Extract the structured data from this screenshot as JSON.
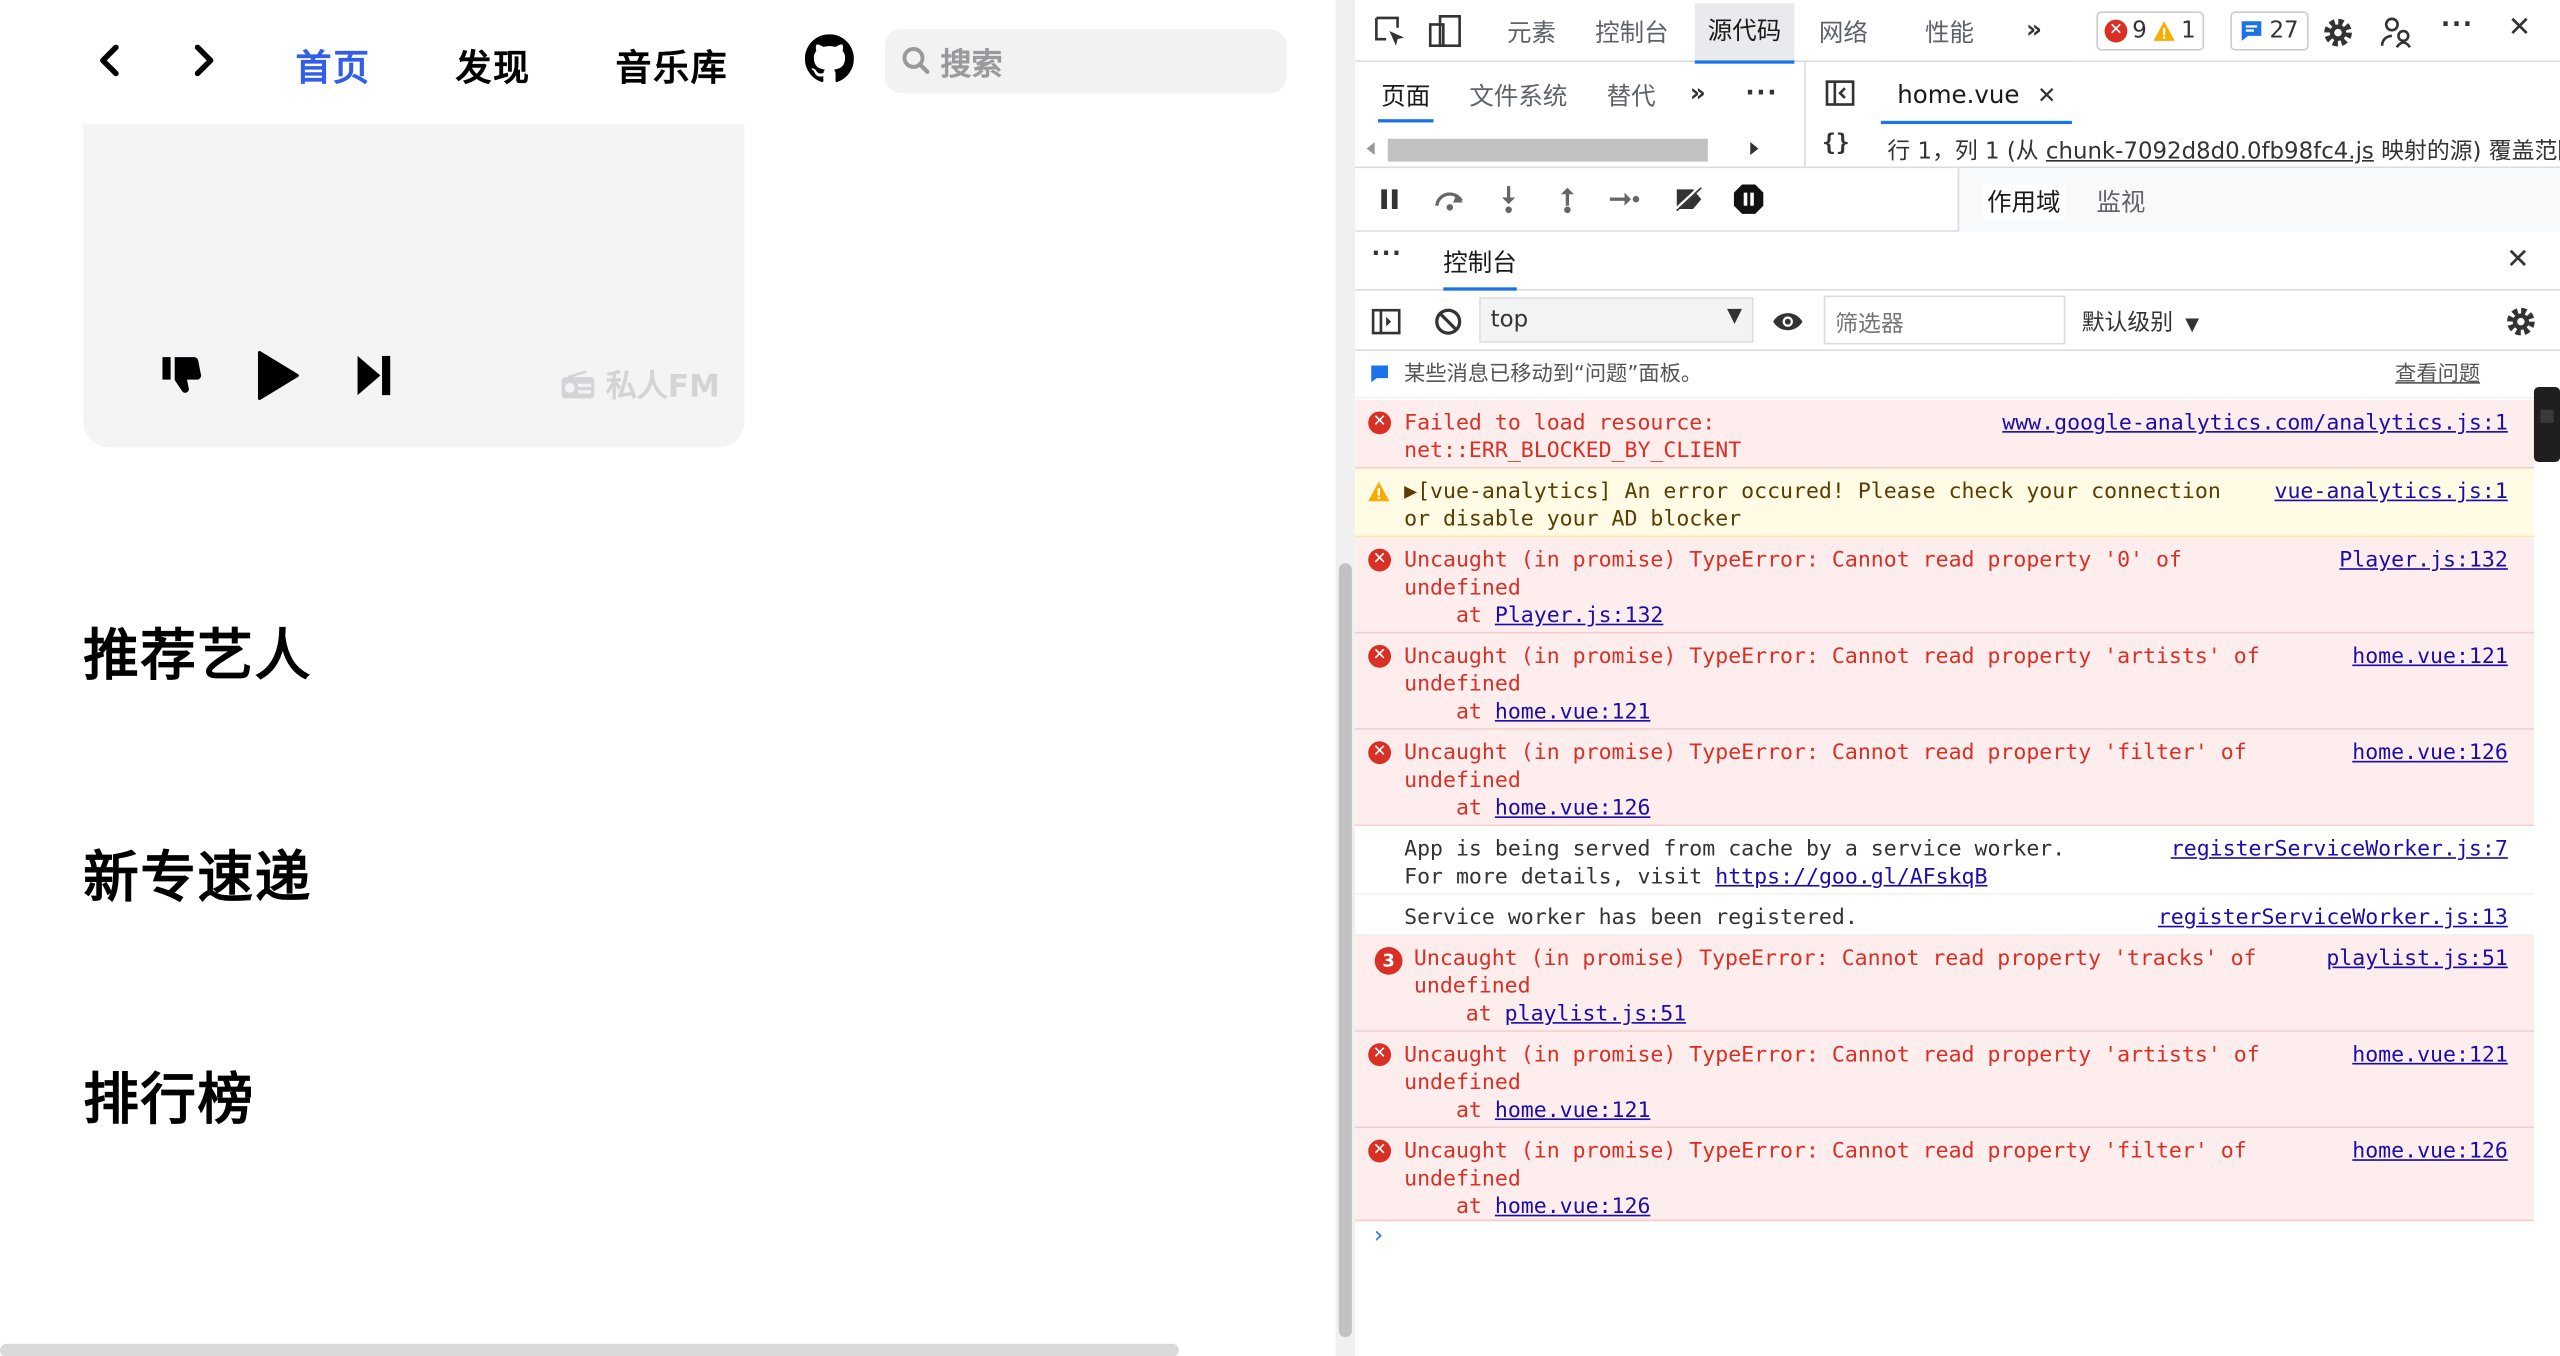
{
  "app": {
    "nav": {
      "home": "首页",
      "discover": "发现",
      "library": "音乐库",
      "search_placeholder": "搜索"
    },
    "fm": {
      "label": "私人FM"
    },
    "sections": {
      "artists": "推荐艺人",
      "albums": "新专速递",
      "charts": "排行榜"
    }
  },
  "devtools": {
    "main_tabs": [
      "元素",
      "控制台",
      "源代码",
      "网络",
      "性能"
    ],
    "issues": {
      "errors": "9",
      "warnings": "1",
      "messages": "27"
    },
    "sources": {
      "nav_tabs": [
        "页面",
        "文件系统",
        "替代"
      ],
      "file_tab": "home.vue",
      "status": {
        "position": "行 1，列 1  (从 ",
        "chunk": "chunk-7092d8d0.0fb98fc4.js",
        "mapped": " 映射的源)  覆盖范围"
      },
      "scope_tabs": [
        "作用域",
        "监视"
      ]
    },
    "drawer": {
      "tab": "控制台"
    },
    "console": {
      "context": "top",
      "filter_placeholder": "筛选器",
      "level": "默认级别",
      "issues_banner": "某些消息已移动到“问题”面板。",
      "issues_link": "查看问题",
      "rows": [
        {
          "msg": "Failed to load resource:\nnet::ERR_BLOCKED_BY_CLIENT",
          "src": "www.google-analytics.com/analytics.js:1"
        },
        {
          "msg": "▶[vue-analytics] An error occured! Please check your connection\nor disable your AD blocker",
          "src": "vue-analytics.js:1"
        },
        {
          "msg": "Uncaught (in promise) TypeError: Cannot read property '0' of\nundefined",
          "at": "Player.js:132",
          "src": "Player.js:132"
        },
        {
          "msg": "Uncaught (in promise) TypeError: Cannot read property 'artists' of\nundefined",
          "at": "home.vue:121",
          "src": "home.vue:121"
        },
        {
          "msg": "Uncaught (in promise) TypeError: Cannot read property 'filter' of\nundefined",
          "at": "home.vue:126",
          "src": "home.vue:126"
        },
        {
          "msg": "App is being served from cache by a service worker.\nFor more details, visit ",
          "link": "https://goo.gl/AFskqB",
          "src": "registerServiceWorker.js:7"
        },
        {
          "msg": "Service worker has been registered.",
          "src": "registerServiceWorker.js:13"
        },
        {
          "count": "3",
          "msg": "Uncaught (in promise) TypeError: Cannot read property 'tracks' of\nundefined",
          "at": "playlist.js:51",
          "src": "playlist.js:51"
        },
        {
          "msg": "Uncaught (in promise) TypeError: Cannot read property 'artists' of\nundefined",
          "at": "home.vue:121",
          "src": "home.vue:121"
        },
        {
          "msg": "Uncaught (in promise) TypeError: Cannot read property 'filter' of\nundefined",
          "at": "home.vue:126",
          "src": "home.vue:126"
        }
      ],
      "at_prefix": "    at "
    }
  }
}
